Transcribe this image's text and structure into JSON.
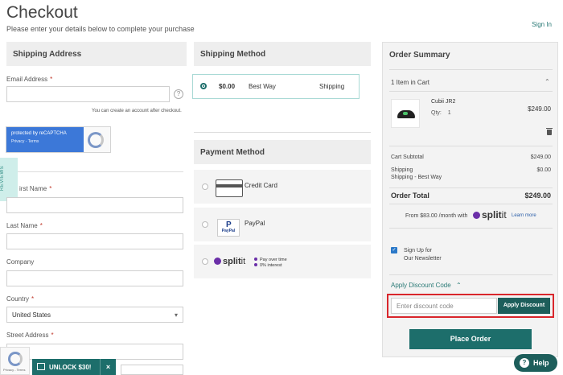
{
  "header": {
    "title": "Checkout",
    "subtitle": "Please enter your details below to complete your purchase",
    "sign_in": "Sign In"
  },
  "shipping_address": {
    "heading": "Shipping Address",
    "email_label": "Email Address",
    "email_help": "?",
    "account_hint": "You can create an account after checkout.",
    "recaptcha_line1": "protected by reCAPTCHA",
    "recaptcha_line2": "Privacy - Terms",
    "reviews_tab": "REVIEWS",
    "first_name_label": "irst Name",
    "last_name_label": "Last Name",
    "company_label": "Company",
    "country_label": "Country",
    "country_value": "United States",
    "street_label": "Street Address",
    "required_mark": "*"
  },
  "shipping_method": {
    "heading": "Shipping Method",
    "option": {
      "price": "$0.00",
      "name": "Best Way",
      "carrier": "Shipping"
    }
  },
  "payment_method": {
    "heading": "Payment Method",
    "options": [
      {
        "label": "Credit Card"
      },
      {
        "label": "PayPal",
        "icon_text": "PayPal"
      },
      {
        "label": "split",
        "label_suffix": "it",
        "features": [
          "Pay over time",
          "0% interest"
        ]
      }
    ]
  },
  "order_summary": {
    "heading": "Order Summary",
    "items_count": "1 Item in Cart",
    "product": {
      "name": "Cubii JR2",
      "qty_label": "Qty:",
      "qty": "1",
      "price": "$249.00"
    },
    "rows": [
      {
        "label": "Cart Subtotal",
        "value": "$249.00"
      },
      {
        "label": "Shipping",
        "sublabel": "Shipping - Best Way",
        "value": "$0.00"
      }
    ],
    "total_label": "Order Total",
    "total_value": "$249.00",
    "splitit_text": "From $83.00 /month with",
    "splitit_logo": "split",
    "splitit_logo_suffix": "it",
    "learn_more": "Learn more",
    "newsletter_line1": "Sign Up for",
    "newsletter_line2": "Our Newsletter",
    "discount_link": "Apply Discount Code",
    "discount_placeholder": "Enter discount code",
    "discount_button": "Apply Discount",
    "place_order": "Place Order"
  },
  "widgets": {
    "unlock": "UNLOCK $30!",
    "unlock_close": "×",
    "recaptcha_badge": "Privacy - Terms",
    "help": "Help",
    "help_q": "?"
  },
  "colors": {
    "brand": "#1d6e6b",
    "highlight": "#d9262c",
    "splitit": "#6b2fa8"
  }
}
